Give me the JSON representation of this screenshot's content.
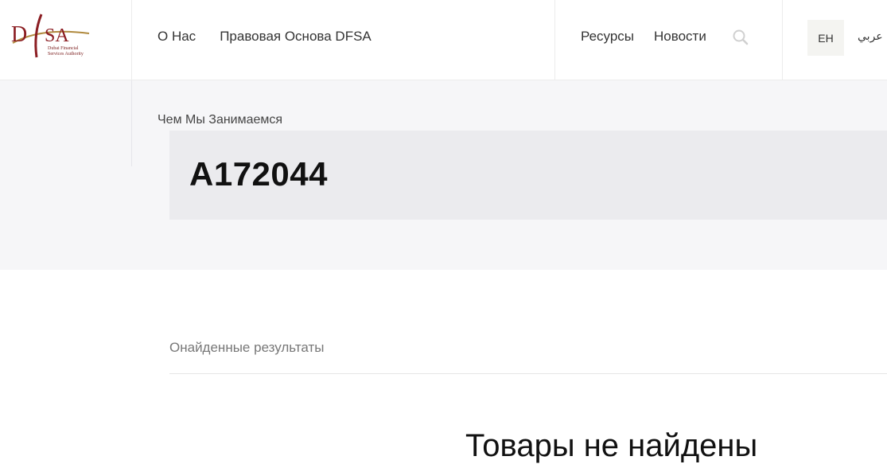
{
  "header": {
    "logo": {
      "wordmark": "DFSA",
      "tagline": "Dubai Financial Services Authority"
    },
    "nav_left": [
      {
        "label": "О Нас"
      },
      {
        "label": "Правовая Основа DFSA"
      }
    ],
    "nav_right": [
      {
        "label": "Ресурсы"
      },
      {
        "label": "Новости"
      }
    ],
    "search_icon": "search-icon",
    "lang_en": "EH",
    "lang_ar": "عربي"
  },
  "hero": {
    "breadcrumb": "Чем Мы Занимаемся",
    "title": "A172044"
  },
  "results": {
    "label": "Онайденные результаты",
    "empty_message": "Товары не найдены"
  },
  "colors": {
    "brand_red": "#8b1d22",
    "brand_gold": "#b08a3e",
    "hero_bg": "#f6f6f8",
    "title_box_bg": "#ebebee"
  }
}
